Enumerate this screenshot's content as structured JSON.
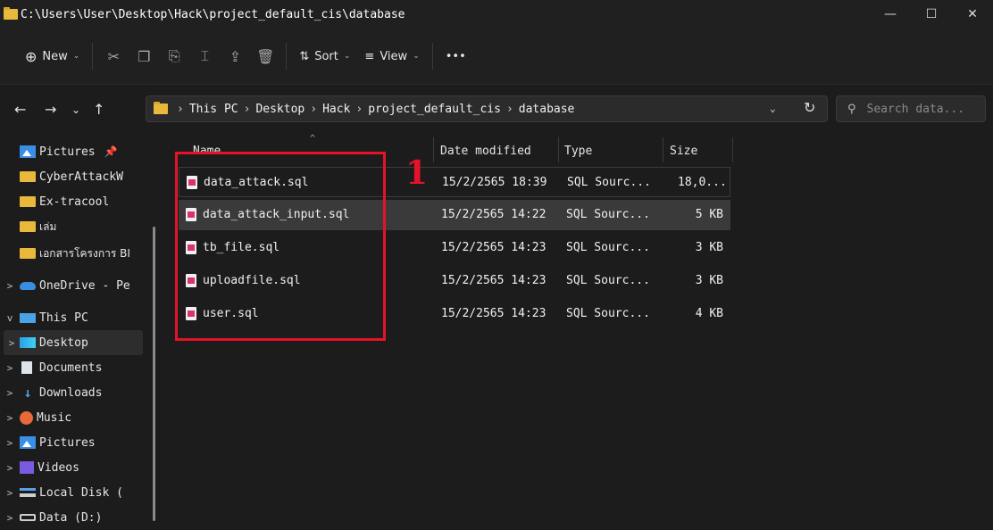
{
  "window": {
    "title": "C:\\Users\\User\\Desktop\\Hack\\project_default_cis\\database",
    "controls": {
      "minimize": "—",
      "maximize": "☐",
      "close": "✕"
    }
  },
  "toolbar": {
    "new_label": "New",
    "sort_label": "Sort",
    "view_label": "View",
    "more_label": "•••"
  },
  "address": {
    "crumbs": [
      "This PC",
      "Desktop",
      "Hack",
      "project_default_cis",
      "database"
    ],
    "search_placeholder": "Search data..."
  },
  "sidebar": {
    "items": [
      {
        "label": "Pictures",
        "icon": "pictures-icon",
        "pinned": true
      },
      {
        "label": "CyberAttackW",
        "icon": "folder-icon"
      },
      {
        "label": "Ex-tracool",
        "icon": "folder-icon"
      },
      {
        "label": "เล่ม",
        "icon": "folder-icon"
      },
      {
        "label": "เอกสารโครงการ BI",
        "icon": "folder-icon"
      },
      {
        "label": "OneDrive - Pe",
        "icon": "cloud-icon",
        "expander": ">"
      },
      {
        "label": "This PC",
        "icon": "pc-icon",
        "expander": "v"
      },
      {
        "label": "Desktop",
        "icon": "desktop-icon",
        "expander": ">",
        "selected": true
      },
      {
        "label": "Documents",
        "icon": "documents-icon",
        "expander": ">"
      },
      {
        "label": "Downloads",
        "icon": "downloads-icon",
        "expander": ">"
      },
      {
        "label": "Music",
        "icon": "music-icon",
        "expander": ">"
      },
      {
        "label": "Pictures",
        "icon": "pictures-icon",
        "expander": ">"
      },
      {
        "label": "Videos",
        "icon": "videos-icon",
        "expander": ">"
      },
      {
        "label": "Local Disk (",
        "icon": "local-disk-icon",
        "expander": ">"
      },
      {
        "label": "Data (D:)",
        "icon": "drive-icon",
        "expander": ">"
      }
    ]
  },
  "columns": {
    "name": "Name",
    "date": "Date modified",
    "type": "Type",
    "size": "Size"
  },
  "files": [
    {
      "name": "data_attack.sql",
      "date": "15/2/2565 18:39",
      "type": "SQL Sourc...",
      "size": "18,0..."
    },
    {
      "name": "data_attack_input.sql",
      "date": "15/2/2565 14:22",
      "type": "SQL Sourc...",
      "size": "5 KB"
    },
    {
      "name": "tb_file.sql",
      "date": "15/2/2565 14:23",
      "type": "SQL Sourc...",
      "size": "3 KB"
    },
    {
      "name": "uploadfile.sql",
      "date": "15/2/2565 14:23",
      "type": "SQL Sourc...",
      "size": "3 KB"
    },
    {
      "name": "user.sql",
      "date": "15/2/2565 14:23",
      "type": "SQL Sourc...",
      "size": "4 KB"
    }
  ],
  "annotation": {
    "label": "1",
    "color": "#e5122a"
  }
}
